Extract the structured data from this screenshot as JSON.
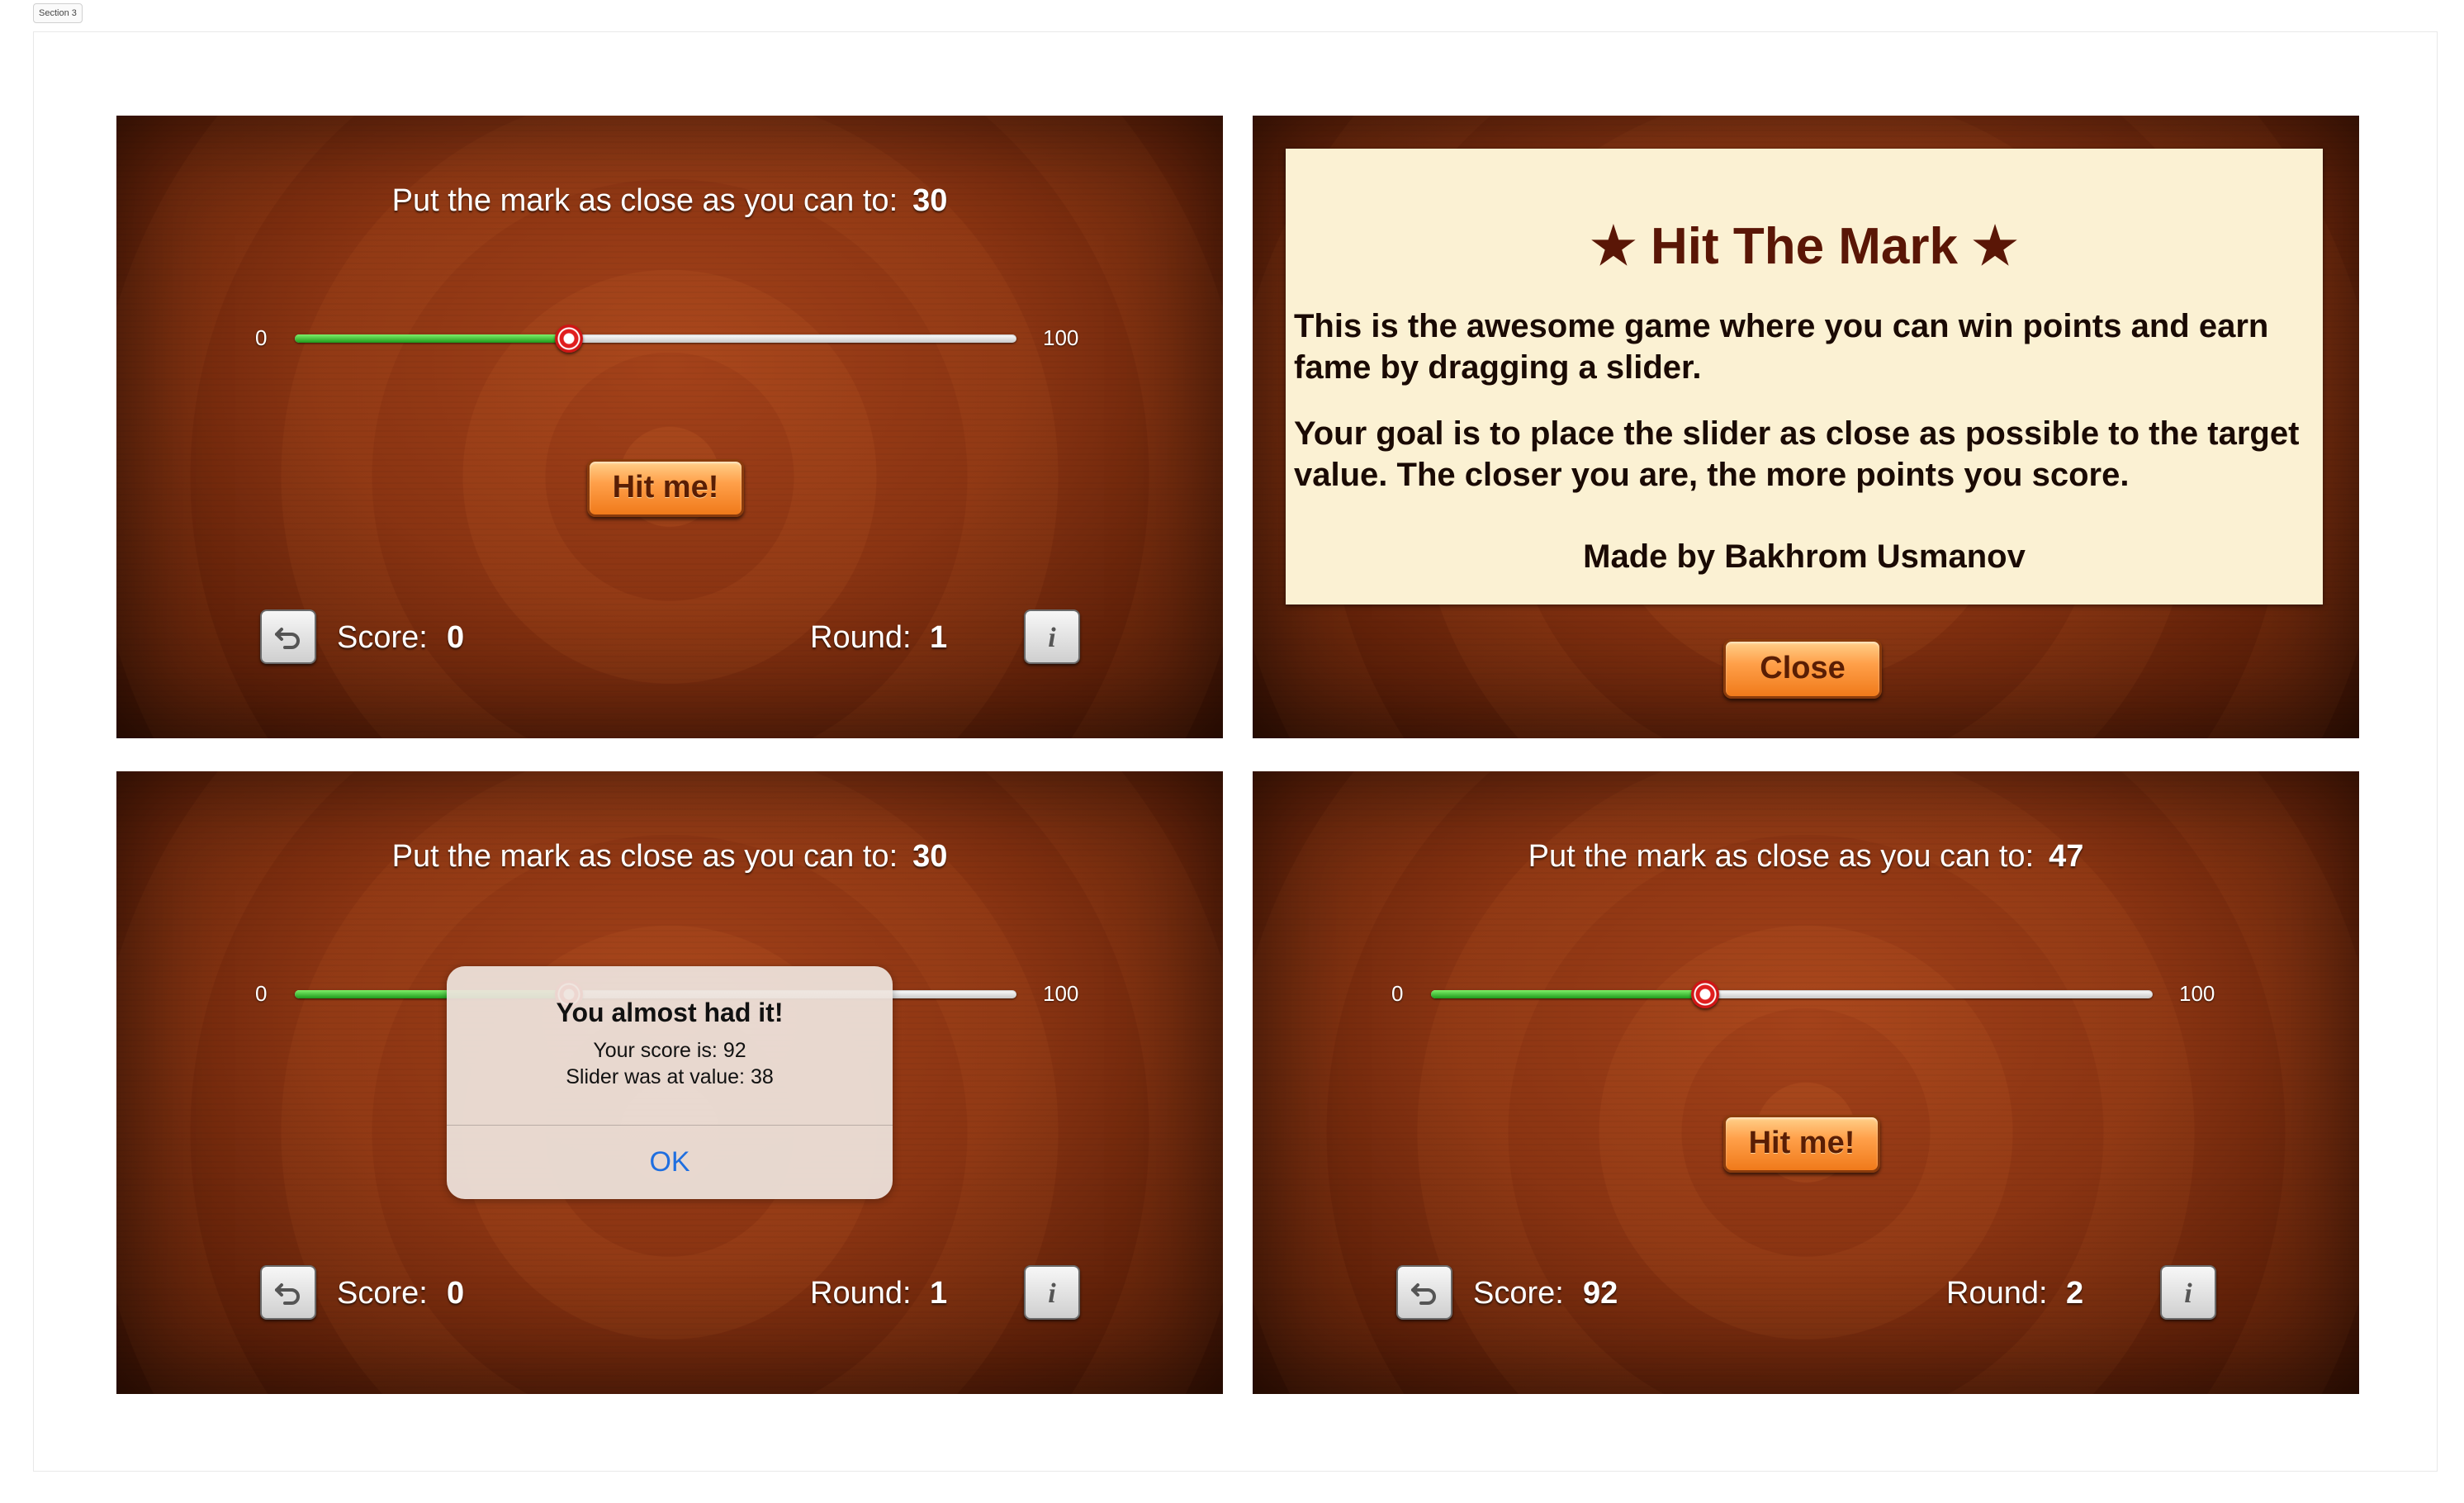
{
  "page": {
    "section_label": "Section 3"
  },
  "colors": {
    "background_wood": "#8a3412",
    "button_orange": "#ffa04a",
    "slider_green": "#1f9a1b",
    "thumb_red": "#e01e1e",
    "about_card": "#fbf1d3",
    "alert_ok_blue": "#1f6fe0"
  },
  "screens": [
    {
      "kind": "game",
      "target_label": "Put the mark as close as you can to:",
      "target_value": "30",
      "slider": {
        "min_label": "0",
        "max_label": "100",
        "value": 38,
        "min": 0,
        "max": 100
      },
      "hit_button": "Hit me!",
      "score_label": "Score:",
      "score_value": "0",
      "round_label": "Round:",
      "round_value": "1",
      "start_over_icon": "start-over-icon",
      "info_icon": "info-icon"
    },
    {
      "kind": "about",
      "title": "★ Hit The Mark ★",
      "paragraph_1": "This is the awesome game where you can win points and earn fame by dragging a slider.",
      "paragraph_2": "Your goal is to place the slider as close as possible to the target value. The closer you are, the more points you score.",
      "credit": "Made by Bakhrom Usmanov",
      "close_button": "Close"
    },
    {
      "kind": "game-alert",
      "target_label": "Put the mark as close as you can to:",
      "target_value": "30",
      "slider": {
        "min_label": "0",
        "max_label": "100",
        "value": 38,
        "min": 0,
        "max": 100
      },
      "score_label": "Score:",
      "score_value": "0",
      "round_label": "Round:",
      "round_value": "1",
      "start_over_icon": "start-over-icon",
      "info_icon": "info-icon",
      "alert": {
        "title": "You almost had it!",
        "line_1": "Your score is: 92",
        "line_2": "Slider was at value: 38",
        "button": "OK"
      }
    },
    {
      "kind": "game",
      "target_label": "Put the mark as close as you can to:",
      "target_value": "47",
      "slider": {
        "min_label": "0",
        "max_label": "100",
        "value": 38,
        "min": 0,
        "max": 100
      },
      "hit_button": "Hit me!",
      "score_label": "Score:",
      "score_value": "92",
      "round_label": "Round:",
      "round_value": "2",
      "start_over_icon": "start-over-icon",
      "info_icon": "info-icon"
    }
  ]
}
